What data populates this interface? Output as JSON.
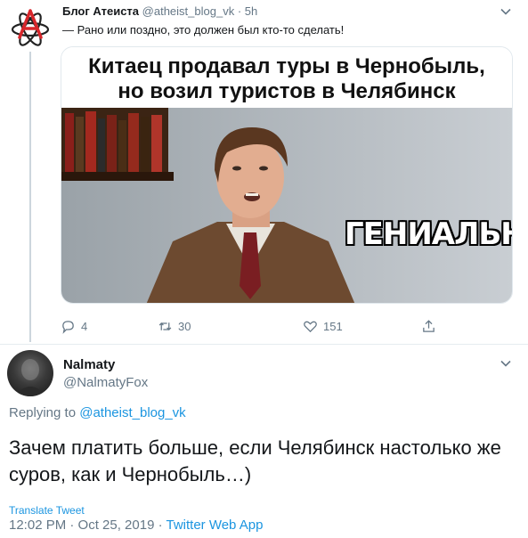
{
  "original_tweet": {
    "display_name": "Блог Атеиста",
    "handle": "@atheist_blog_vk",
    "separator": "·",
    "time": "5h",
    "text": "— Рано или поздно, это должен был кто-то сделать!",
    "media": {
      "headline_line1": "Китаец продавал туры в Чернобыль,",
      "headline_line2": "но возил туристов в Челябинск",
      "caption": "ГЕНИАЛЬНО"
    },
    "actions": {
      "replies": "4",
      "retweets": "30",
      "likes": "151"
    },
    "icons": [
      "atheism-logo-icon",
      "chevron-down-icon",
      "reply-icon",
      "retweet-icon",
      "like-icon",
      "share-icon"
    ]
  },
  "reply_tweet": {
    "display_name": "Nalmaty",
    "handle": "@NalmatyFox",
    "replying_prefix": "Replying to",
    "replying_to": "@atheist_blog_vk",
    "text": "Зачем платить больше, если Челябинск настолько же суров, как и Чернобыль…)",
    "translate_label": "Translate Tweet",
    "timestamp": "12:02 PM · Oct 25, 2019 · ",
    "app": "Twitter Web App"
  },
  "colors": {
    "link": "#1b95e0",
    "secondary_text": "#657786",
    "primary_text": "#14171a",
    "logo_red": "#d8262b"
  }
}
